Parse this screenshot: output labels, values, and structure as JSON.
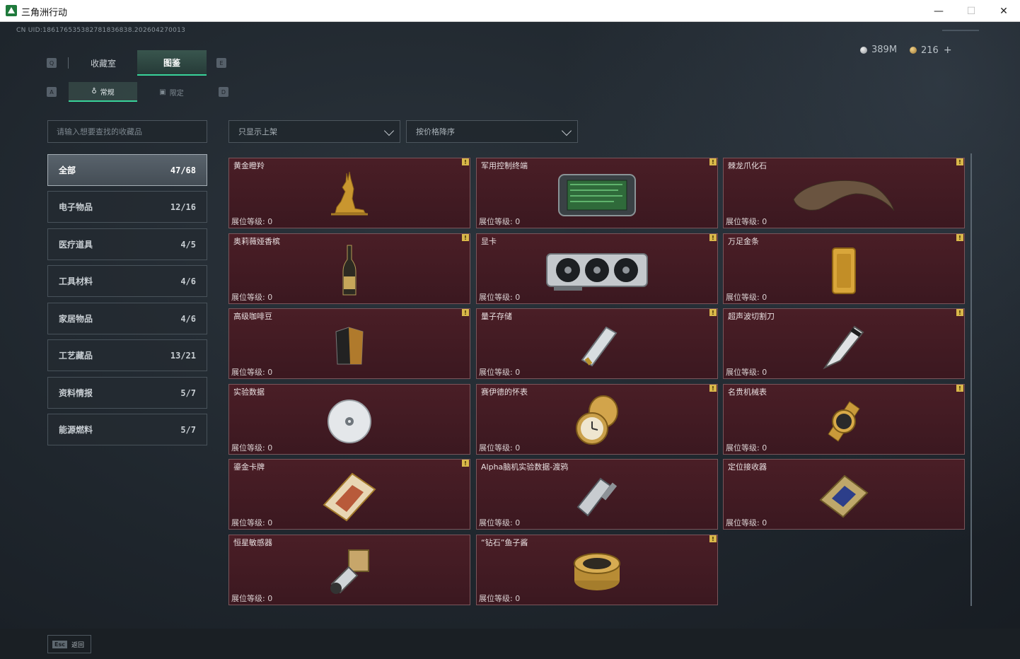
{
  "window": {
    "title": "三角洲行动",
    "minimize": "—",
    "maximize": "☐",
    "close": "✕"
  },
  "uid": "CN UID:18617653538278183683​8.202604270013",
  "currency": {
    "silver": "389M",
    "gold": "216",
    "plus": "+"
  },
  "keys": {
    "left_tab": "Q",
    "right_tab": "E",
    "left_sub": "A",
    "right_sub": "D"
  },
  "tabs": [
    {
      "label": "收藏室"
    },
    {
      "label": "图鉴"
    }
  ],
  "subtabs": [
    {
      "label": "常规",
      "icon": "♁"
    },
    {
      "label": "限定",
      "icon": "▣"
    }
  ],
  "search": {
    "placeholder": "请输入想要查找的收藏品"
  },
  "filters": {
    "shelf": "只显示上架",
    "sort": "按价格降序"
  },
  "categories": [
    {
      "label": "全部",
      "count": "47/68"
    },
    {
      "label": "电子物品",
      "count": "12/16"
    },
    {
      "label": "医疗道具",
      "count": "4/5"
    },
    {
      "label": "工具材料",
      "count": "4/6"
    },
    {
      "label": "家居物品",
      "count": "4/6"
    },
    {
      "label": "工艺藏品",
      "count": "13/21"
    },
    {
      "label": "资料情报",
      "count": "5/7"
    },
    {
      "label": "能源燃料",
      "count": "5/7"
    }
  ],
  "items": [
    {
      "name": "黄金瞪羚",
      "level": "展位等级: 0",
      "badge": "!"
    },
    {
      "name": "军用控制终端",
      "level": "展位等级: 0",
      "badge": "!"
    },
    {
      "name": "棘龙爪化石",
      "level": "展位等级: 0",
      "badge": "!"
    },
    {
      "name": "奥莉薇娅香槟",
      "level": "展位等级: 0",
      "badge": "!"
    },
    {
      "name": "显卡",
      "level": "展位等级: 0",
      "badge": "!"
    },
    {
      "name": "万足金条",
      "level": "展位等级: 0",
      "badge": "!"
    },
    {
      "name": "高级咖啡豆",
      "level": "展位等级: 0",
      "badge": "!"
    },
    {
      "name": "量子存储",
      "level": "展位等级: 0",
      "badge": "!"
    },
    {
      "name": "超声波切割刀",
      "level": "展位等级: 0",
      "badge": "!"
    },
    {
      "name": "实验数据",
      "level": "展位等级: 0",
      "badge": ""
    },
    {
      "name": "赛伊德的怀表",
      "level": "展位等级: 0",
      "badge": "!"
    },
    {
      "name": "名贵机械表",
      "level": "展位等级: 0",
      "badge": "!"
    },
    {
      "name": "鎏金卡牌",
      "level": "展位等级: 0",
      "badge": "!"
    },
    {
      "name": "Alpha脑机实验数据-渡鸦",
      "level": "展位等级: 0",
      "badge": ""
    },
    {
      "name": "定位接收器",
      "level": "展位等级: 0",
      "badge": ""
    },
    {
      "name": "恒星敏感器",
      "level": "展位等级: 0",
      "badge": ""
    },
    {
      "name": "“钻石”鱼子酱",
      "level": "展位等级: 0",
      "badge": "!"
    }
  ],
  "footer": {
    "esc_key": "Esc",
    "esc_label": "返回"
  },
  "colors": {
    "accent": "#39d39a",
    "card_bg": "#4a1e26",
    "badge": "#d9b84a"
  }
}
